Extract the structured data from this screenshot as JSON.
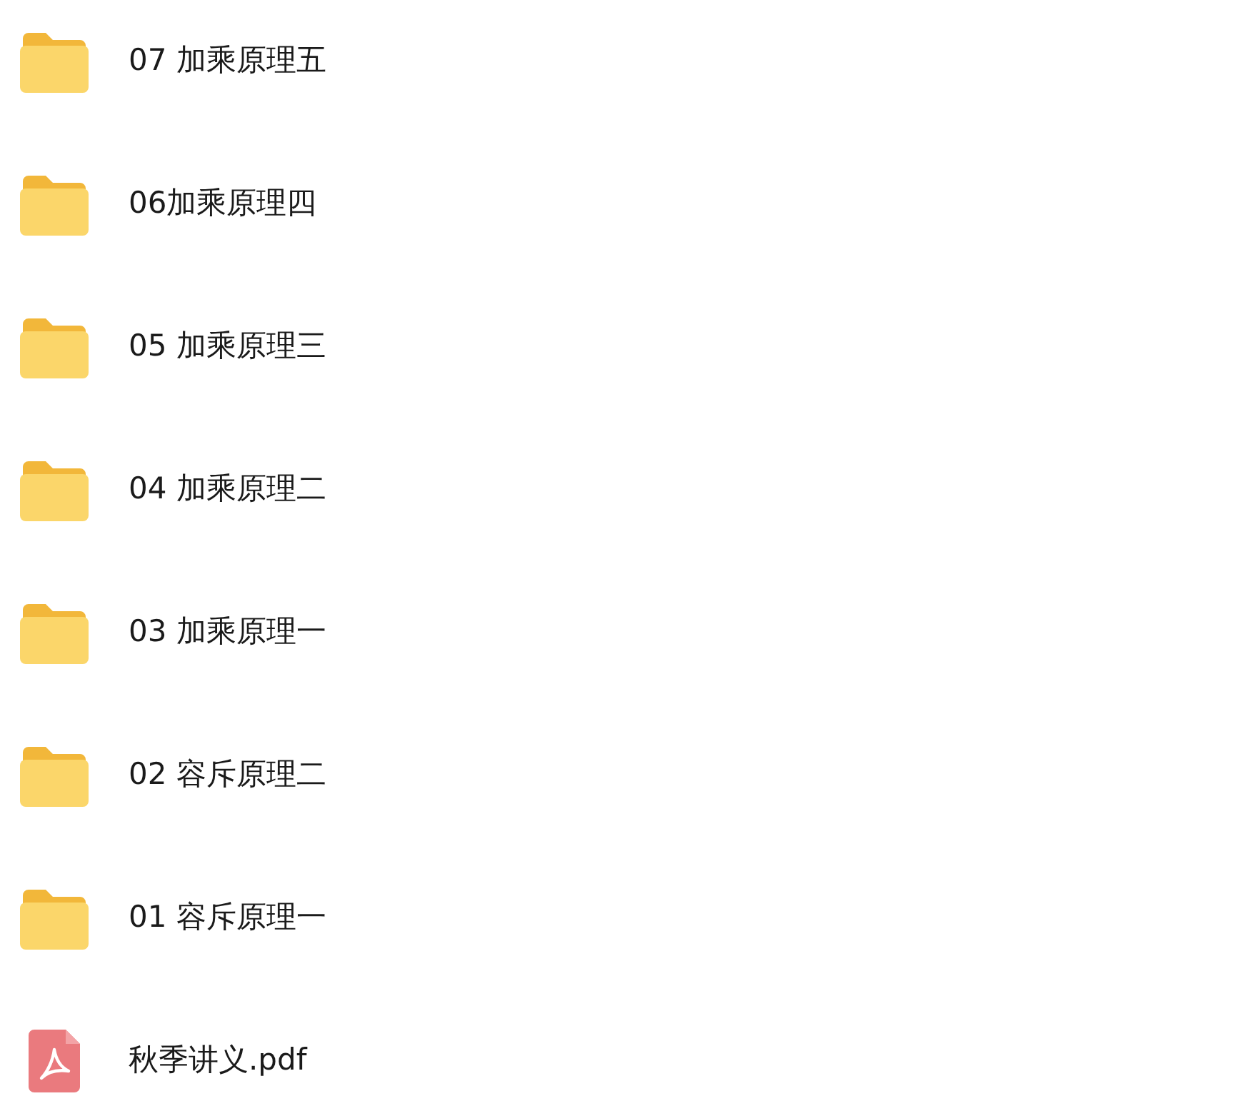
{
  "files": [
    {
      "kind": "folder",
      "name": "07 加乘原理五"
    },
    {
      "kind": "folder",
      "name": "06加乘原理四"
    },
    {
      "kind": "folder",
      "name": "05 加乘原理三"
    },
    {
      "kind": "folder",
      "name": "04 加乘原理二"
    },
    {
      "kind": "folder",
      "name": "03 加乘原理一"
    },
    {
      "kind": "folder",
      "name": "02 容斥原理二"
    },
    {
      "kind": "folder",
      "name": "01 容斥原理一"
    },
    {
      "kind": "pdf",
      "name": "秋季讲义.pdf"
    }
  ]
}
